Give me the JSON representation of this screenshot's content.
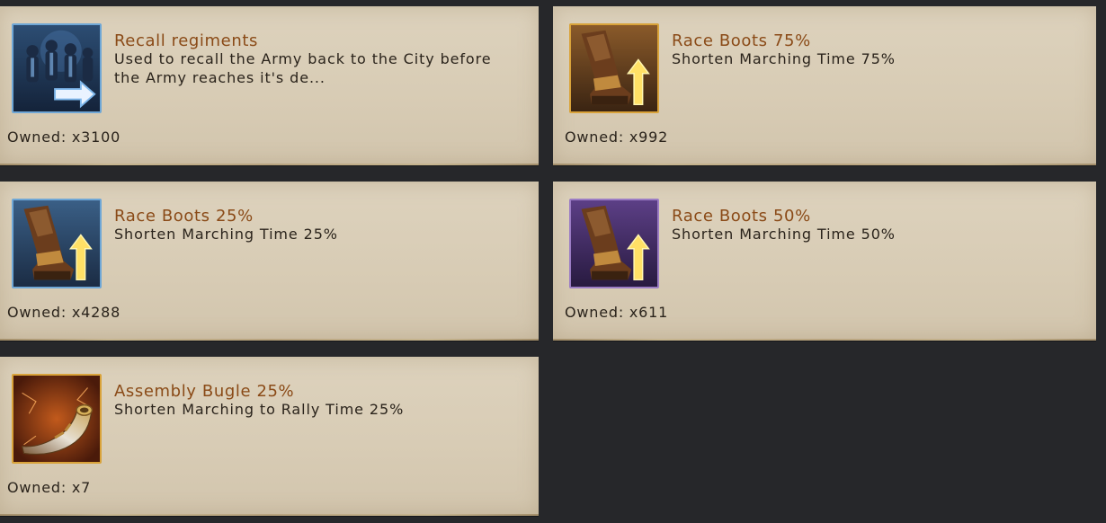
{
  "items": [
    {
      "title": "Recall regiments",
      "description": "Used to recall the Army back to the City before\n the Army reaches it's de...",
      "owned": "Owned: x3100",
      "icon": "recall-regiments-icon",
      "frame_color": "#6fa7d6"
    },
    {
      "title": "Race Boots 75%",
      "description": "Shorten Marching Time 75%",
      "owned": "Owned: x992",
      "icon": "race-boots-icon",
      "frame_color": "#d9a33a"
    },
    {
      "title": "Race Boots 25%",
      "description": "Shorten Marching Time 25%",
      "owned": "Owned: x4288",
      "icon": "race-boots-icon",
      "frame_color": "#6fa7d6"
    },
    {
      "title": "Race Boots 50%",
      "description": "Shorten Marching Time 50%",
      "owned": "Owned: x611",
      "icon": "race-boots-icon",
      "frame_color": "#9b7cc4"
    },
    {
      "title": "Assembly Bugle 25%",
      "description": "Shorten Marching to Rally Time 25%",
      "owned": "Owned: x7",
      "icon": "assembly-bugle-icon",
      "frame_color": "#d9a33a"
    }
  ]
}
